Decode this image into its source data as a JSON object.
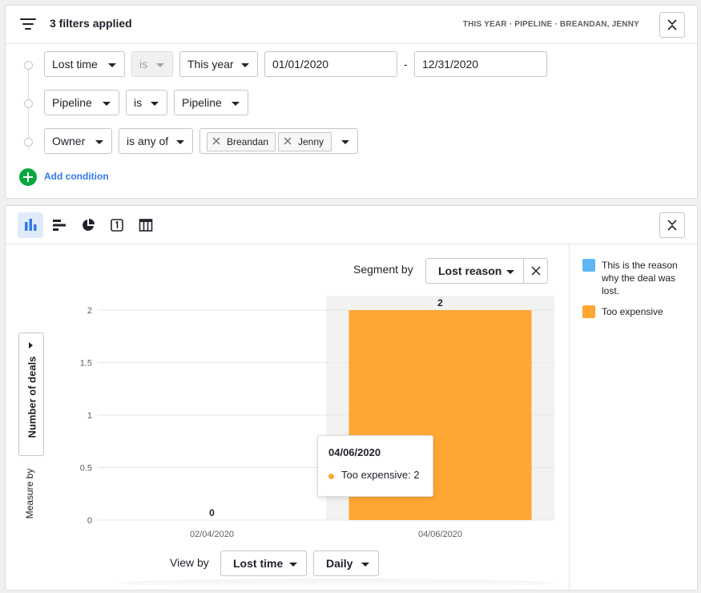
{
  "filters": {
    "title": "3 filters applied",
    "summary": "THIS YEAR · PIPELINE · BREANDAN, JENNY",
    "rows": [
      {
        "field": "Lost time",
        "operator": "is",
        "value": "This year",
        "date_from": "01/01/2020",
        "date_separator": "-",
        "date_to": "12/31/2020"
      },
      {
        "field": "Pipeline",
        "operator": "is",
        "value": "Pipeline"
      },
      {
        "field": "Owner",
        "operator": "is any of",
        "tags": [
          "Breandan",
          "Jenny"
        ]
      }
    ],
    "add_condition": "Add condition"
  },
  "report": {
    "toolbar_icons": [
      "bar-chart-icon",
      "horizontal-bar-icon",
      "pie-chart-icon",
      "scorecard-icon",
      "table-icon"
    ],
    "segment_label": "Segment by",
    "segment_value": "Lost reason",
    "measure_label": "Number of deals",
    "measure_by": "Measure by",
    "view_by_label": "View by",
    "view_by_value": "Lost time",
    "interval_value": "Daily",
    "tooltip": {
      "title": "04/06/2020",
      "row": "Too expensive: 2"
    }
  },
  "legend": [
    {
      "label": "This is the reason why the deal was lost.",
      "color": "#5eb6f5"
    },
    {
      "label": "Too expensive",
      "color": "#ffa633"
    }
  ],
  "chart_data": {
    "type": "bar",
    "categories": [
      "02/04/2020",
      "04/06/2020"
    ],
    "series": [
      {
        "name": "This is the reason why the deal was lost.",
        "values": [
          0,
          0
        ]
      },
      {
        "name": "Too expensive",
        "values": [
          0,
          2
        ]
      }
    ],
    "totals": [
      "0",
      "2"
    ],
    "y_ticks": [
      "0",
      "0.5",
      "1",
      "1.5",
      "2"
    ],
    "ylim": [
      0,
      2
    ],
    "highlighted_category": "04/06/2020",
    "grid": true
  }
}
